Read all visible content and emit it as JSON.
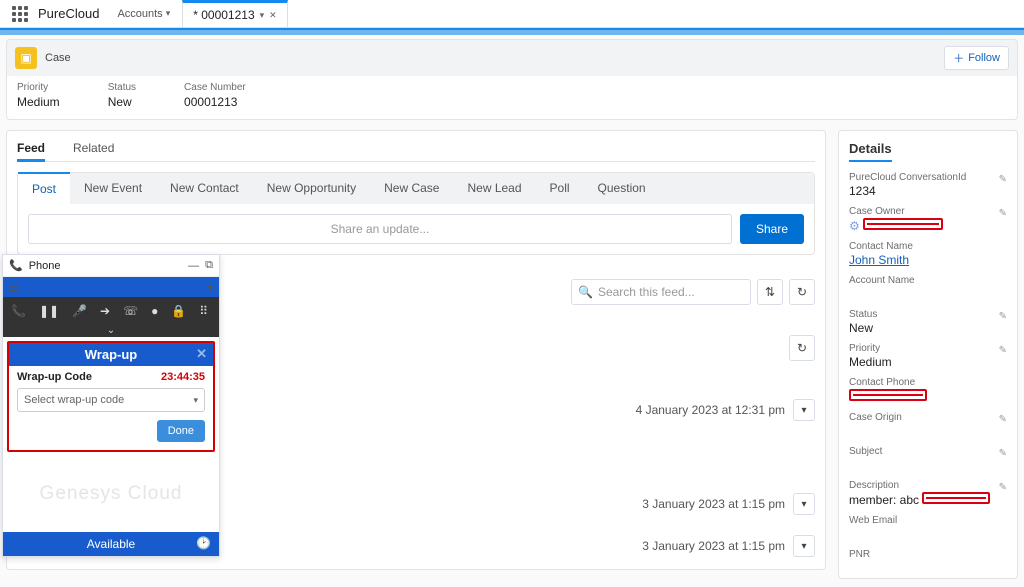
{
  "app": {
    "name": "PureCloud"
  },
  "topnav": {
    "accounts": "Accounts",
    "active_tab": "* 00001213"
  },
  "case_header": {
    "object": "Case",
    "follow": "Follow",
    "priority_label": "Priority",
    "priority": "Medium",
    "status_label": "Status",
    "status": "New",
    "number_label": "Case Number",
    "number": "00001213"
  },
  "left": {
    "tabs1": {
      "feed": "Feed",
      "related": "Related"
    },
    "tabs2": {
      "post": "Post",
      "new_event": "New Event",
      "new_contact": "New Contact",
      "new_opportunity": "New Opportunity",
      "new_case": "New Case",
      "new_lead": "New Lead",
      "poll": "Poll",
      "question": "Question"
    },
    "compose_placeholder": "Share an update...",
    "share": "Share",
    "search_placeholder": "Search this feed...",
    "feed_items": [
      "4 January 2023 at 12:31 pm",
      "3 January 2023 at 1:15 pm",
      "3 January 2023 at 1:15 pm"
    ]
  },
  "details": {
    "title": "Details",
    "fields": {
      "conversation_label": "PureCloud ConversationId",
      "conversation": "1234",
      "owner_label": "Case Owner",
      "owner": "████████",
      "contact_label": "Contact Name",
      "contact": "John Smith",
      "account_label": "Account Name",
      "status_label": "Status",
      "status": "New",
      "priority_label": "Priority",
      "priority": "Medium",
      "phone_label": "Contact Phone",
      "origin_label": "Case Origin",
      "subject_label": "Subject",
      "description_label": "Description",
      "description": "member: abc",
      "web_email_label": "Web Email",
      "pnr_label": "PNR"
    }
  },
  "phone": {
    "title": "Phone",
    "brand": "Genesys Cloud",
    "status": "Available",
    "wrapup": {
      "title": "Wrap-up",
      "code_label": "Wrap-up Code",
      "timer": "23:44:35",
      "select_placeholder": "Select wrap-up code",
      "done": "Done"
    }
  }
}
